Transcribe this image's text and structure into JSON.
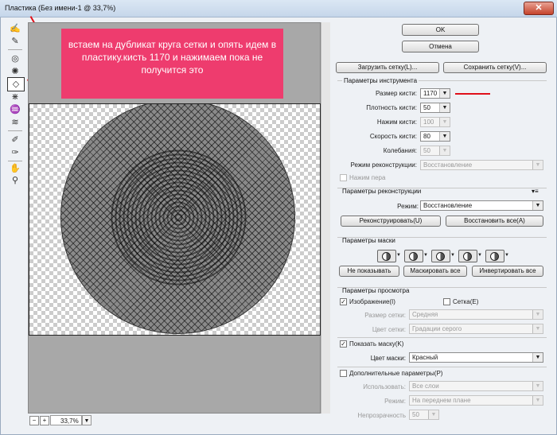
{
  "window": {
    "title": "Пластика (Без имени-1 @ 33,7%)",
    "close": "✕"
  },
  "annotation": "встаем на дубликат круга сетки и опять идем в пластику.кисть 1170 и нажимаем пока не получится это",
  "zoom": {
    "value": "33,7%",
    "minus": "−",
    "plus": "+"
  },
  "buttons": {
    "ok": "OK",
    "cancel": "Отмена",
    "load_mesh": "Загрузить сетку(L)...",
    "save_mesh": "Сохранить сетку(V)..."
  },
  "tool_options": {
    "title": "Параметры инструмента",
    "brush_size": {
      "label": "Размер кисти:",
      "value": "1170"
    },
    "brush_density": {
      "label": "Плотность кисти:",
      "value": "50"
    },
    "brush_pressure": {
      "label": "Нажим кисти:",
      "value": "100"
    },
    "brush_rate": {
      "label": "Скорость кисти:",
      "value": "80"
    },
    "turbulent_jitter": {
      "label": "Колебания:",
      "value": "50"
    },
    "reconstruct_mode": {
      "label": "Режим реконструкции:",
      "value": "Восстановление"
    },
    "stylus_pressure": "Нажим пера"
  },
  "reconstruct_options": {
    "title": "Параметры реконструкции",
    "menu_icon": "▾≡",
    "mode": {
      "label": "Режим:",
      "value": "Восстановление"
    },
    "reconstruct_btn": "Реконструировать(U)",
    "restore_all_btn": "Восстановить все(A)"
  },
  "mask_options": {
    "title": "Параметры маски",
    "none_btn": "Не показывать",
    "mask_all_btn": "Маскировать все",
    "invert_all_btn": "Инвертировать все"
  },
  "view_options": {
    "title": "Параметры просмотра",
    "show_image": {
      "label": "Изображение(I)",
      "checked": true
    },
    "show_mesh": {
      "label": "Сетка(E)",
      "checked": false
    },
    "mesh_size": {
      "label": "Размер сетки:",
      "value": "Средняя"
    },
    "mesh_color": {
      "label": "Цвет сетки:",
      "value": "Градации серого"
    },
    "show_mask": {
      "label": "Показать маску(K)",
      "checked": true
    },
    "mask_color": {
      "label": "Цвет маски:",
      "value": "Красный"
    },
    "show_backdrop": {
      "label": "Дополнительные параметры(P)",
      "checked": false
    },
    "use": {
      "label": "Использовать:",
      "value": "Все слои"
    },
    "mode": {
      "label": "Режим:",
      "value": "На переднем плане"
    },
    "opacity": {
      "label": "Непрозрачность",
      "value": "50"
    }
  },
  "check_mark": "✓",
  "dropdown_arrow": "▼",
  "colors": {
    "annotation_bg": "#ee3c6e",
    "arrow": "#e0101a"
  }
}
